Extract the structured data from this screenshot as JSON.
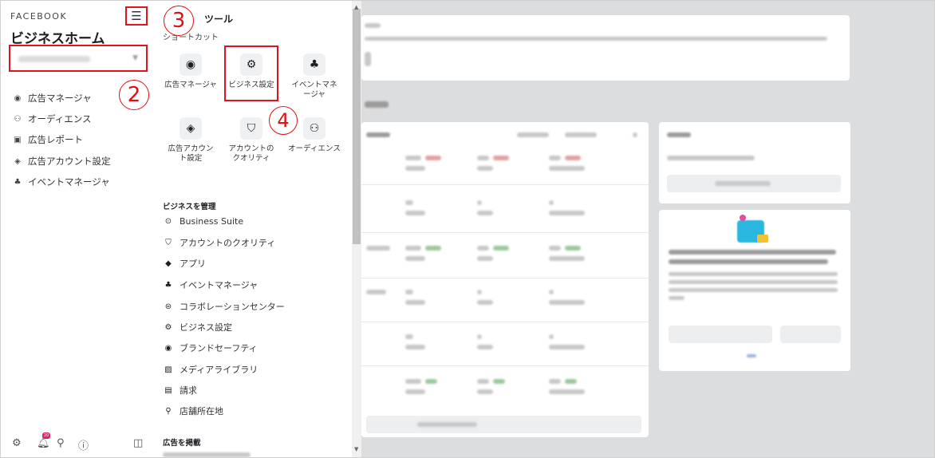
{
  "sidebar": {
    "brand": "FACEBOOK",
    "title": "ビジネスホーム",
    "menu_icon": "menu-icon",
    "nav": [
      {
        "label": "広告マネージャ",
        "icon": "ads-manager-icon"
      },
      {
        "label": "オーディエンス",
        "icon": "audience-icon"
      },
      {
        "label": "広告レポート",
        "icon": "ads-report-icon"
      },
      {
        "label": "広告アカウント設定",
        "icon": "ad-account-settings-icon"
      },
      {
        "label": "イベントマネージャ",
        "icon": "events-manager-icon"
      }
    ],
    "footer_icons": [
      "settings-icon",
      "notifications-icon",
      "search-icon",
      "help-icon",
      "panel-toggle-icon"
    ],
    "notification_count": "20"
  },
  "annotations": {
    "n2": "2",
    "n3": "3",
    "n4": "4"
  },
  "tools": {
    "title": "ツール",
    "shortcut_label": "ショートカット",
    "tiles": [
      {
        "label": "広告マネージャ",
        "icon": "ads-manager-icon"
      },
      {
        "label": "ビジネス設定",
        "icon": "gear-icon"
      },
      {
        "label": "イベントマネージャ",
        "icon": "events-manager-icon"
      },
      {
        "label": "広告アカウント設定",
        "icon": "ad-account-settings-icon"
      },
      {
        "label": "アカウントのクオリティ",
        "icon": "account-quality-icon"
      },
      {
        "label": "オーディエンス",
        "icon": "audience-icon"
      }
    ],
    "manage_heading": "ビジネスを管理",
    "manage_items": [
      {
        "label": "Business Suite",
        "icon": "business-suite-icon"
      },
      {
        "label": "アカウントのクオリティ",
        "icon": "account-quality-icon"
      },
      {
        "label": "アプリ",
        "icon": "apps-icon"
      },
      {
        "label": "イベントマネージャ",
        "icon": "events-manager-icon"
      },
      {
        "label": "コラボレーションセンター",
        "icon": "collaboration-center-icon"
      },
      {
        "label": "ビジネス設定",
        "icon": "gear-icon"
      },
      {
        "label": "ブランドセーフティ",
        "icon": "brand-safety-icon"
      },
      {
        "label": "メディアライブラリ",
        "icon": "media-library-icon"
      },
      {
        "label": "請求",
        "icon": "billing-icon"
      },
      {
        "label": "店舗所在地",
        "icon": "store-location-icon"
      }
    ],
    "advertise_heading": "広告を掲載"
  }
}
